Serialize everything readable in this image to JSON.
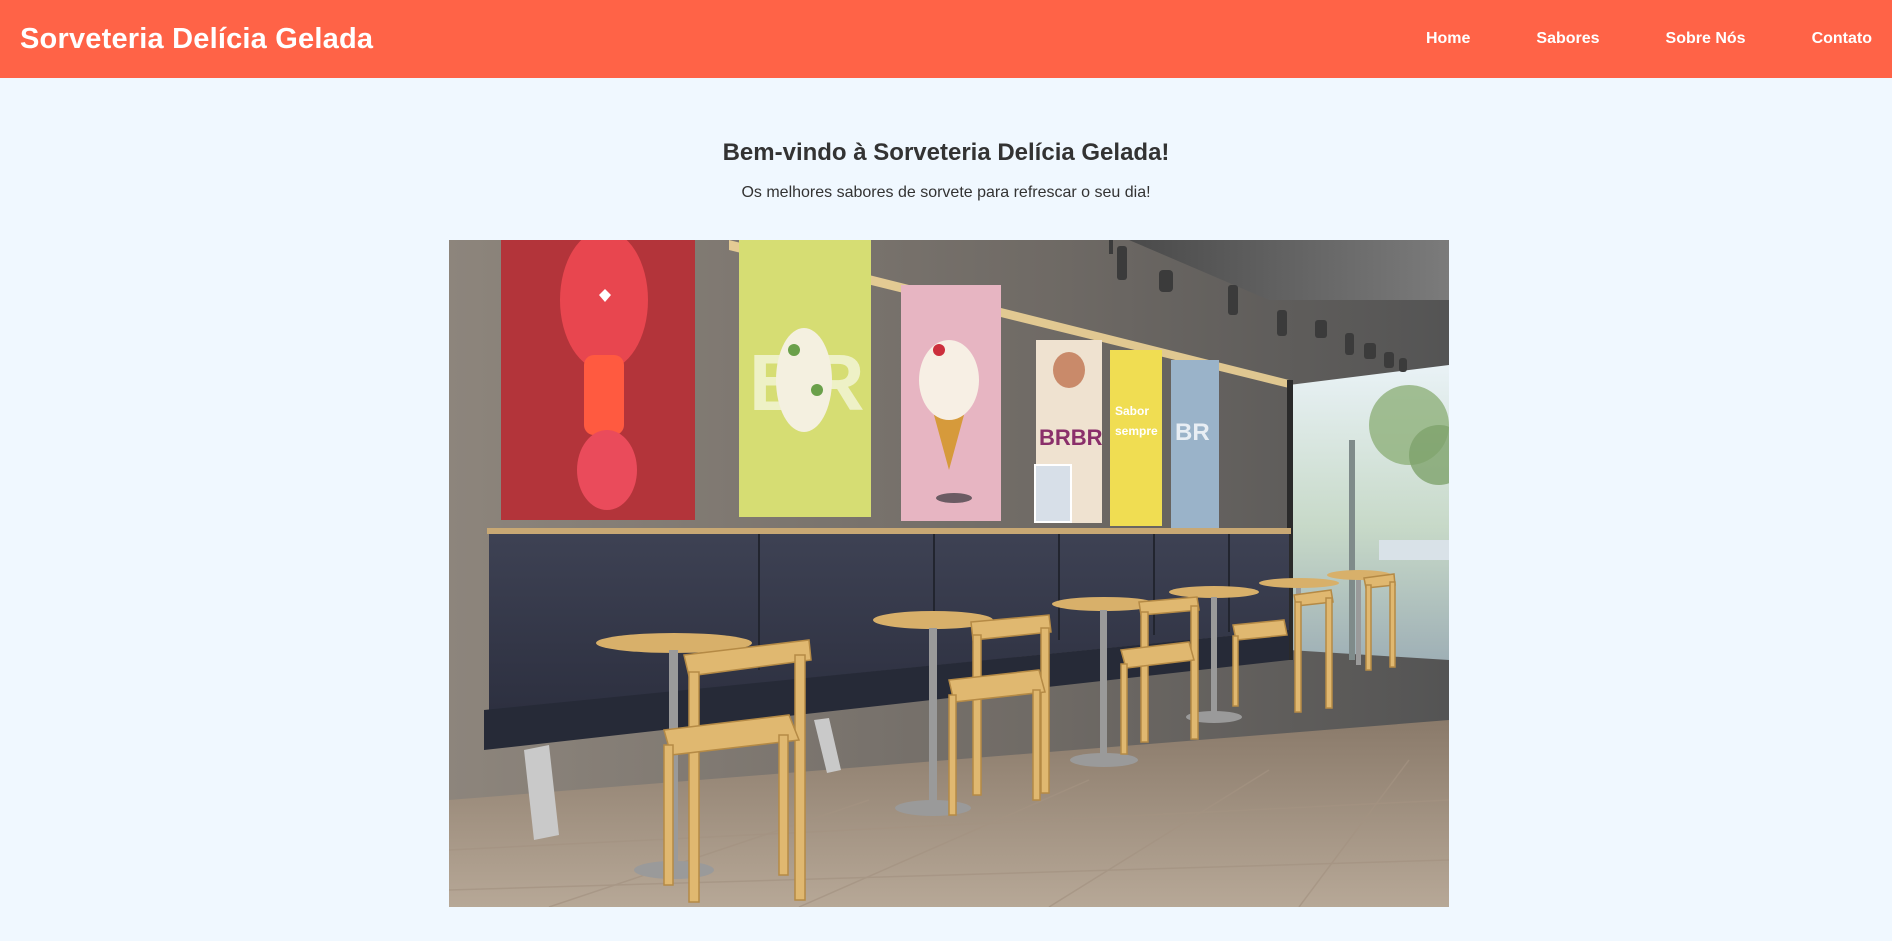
{
  "header": {
    "brand": "Sorveteria Delícia Gelada",
    "nav": [
      {
        "label": "Home"
      },
      {
        "label": "Sabores"
      },
      {
        "label": "Sobre Nós"
      },
      {
        "label": "Contato"
      }
    ]
  },
  "hero": {
    "title": "Bem-vindo à Sorveteria Delícia Gelada!",
    "subtitle": "Os melhores sabores de sorvete para refrescar o seu dia!"
  },
  "colors": {
    "header_bg": "#ff6347",
    "page_bg": "#f0f8ff",
    "text": "#333333"
  }
}
